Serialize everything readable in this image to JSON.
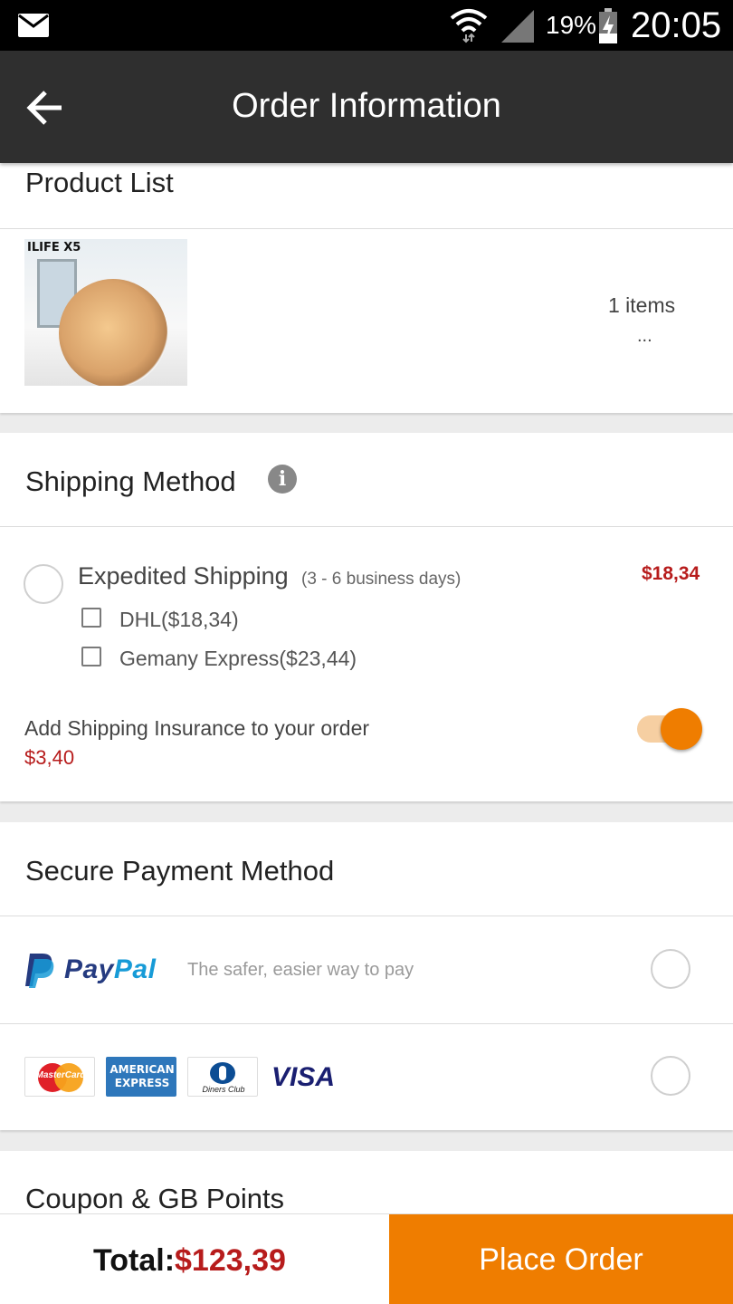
{
  "status_bar": {
    "battery_percent": "19%",
    "time": "20:05",
    "icons": [
      "mail-icon",
      "wifi-icon",
      "signal-icon",
      "battery-icon"
    ]
  },
  "app_bar": {
    "title": "Order Information",
    "back_icon": "arrow-left-icon"
  },
  "product_list": {
    "title": "Product List",
    "product_image_brand": "ILIFE X5",
    "items_count": "1 items",
    "more": "..."
  },
  "shipping": {
    "title": "Shipping Method",
    "info_icon": "i",
    "method_name": "Expedited Shipping",
    "method_days": "(3 - 6 business days)",
    "method_price": "$18,34",
    "options": [
      {
        "label": "DHL($18,34)",
        "checked": false
      },
      {
        "label": "Gemany Express($23,44)",
        "checked": false
      }
    ],
    "insurance_label": "Add Shipping Insurance to your order",
    "insurance_price": "$3,40",
    "insurance_enabled": true
  },
  "payment": {
    "title": "Secure Payment Method",
    "paypal_pay": "Pay",
    "paypal_pal": "Pal",
    "paypal_tagline": "The safer, easier way to pay",
    "card_logos": {
      "mastercard": "MasterCard",
      "amex_line1": "AMERICAN",
      "amex_line2": "EXPRESS",
      "diners": "Diners Club",
      "visa": "VISA"
    }
  },
  "coupon": {
    "title": "Coupon & GB Points"
  },
  "bottom_bar": {
    "total_label": "Total:",
    "total_amount": "$123,39",
    "place_order_label": "Place Order"
  },
  "colors": {
    "accent": "#ef7d00",
    "price_red": "#b71c1c",
    "app_bar": "#2f2f2f"
  }
}
